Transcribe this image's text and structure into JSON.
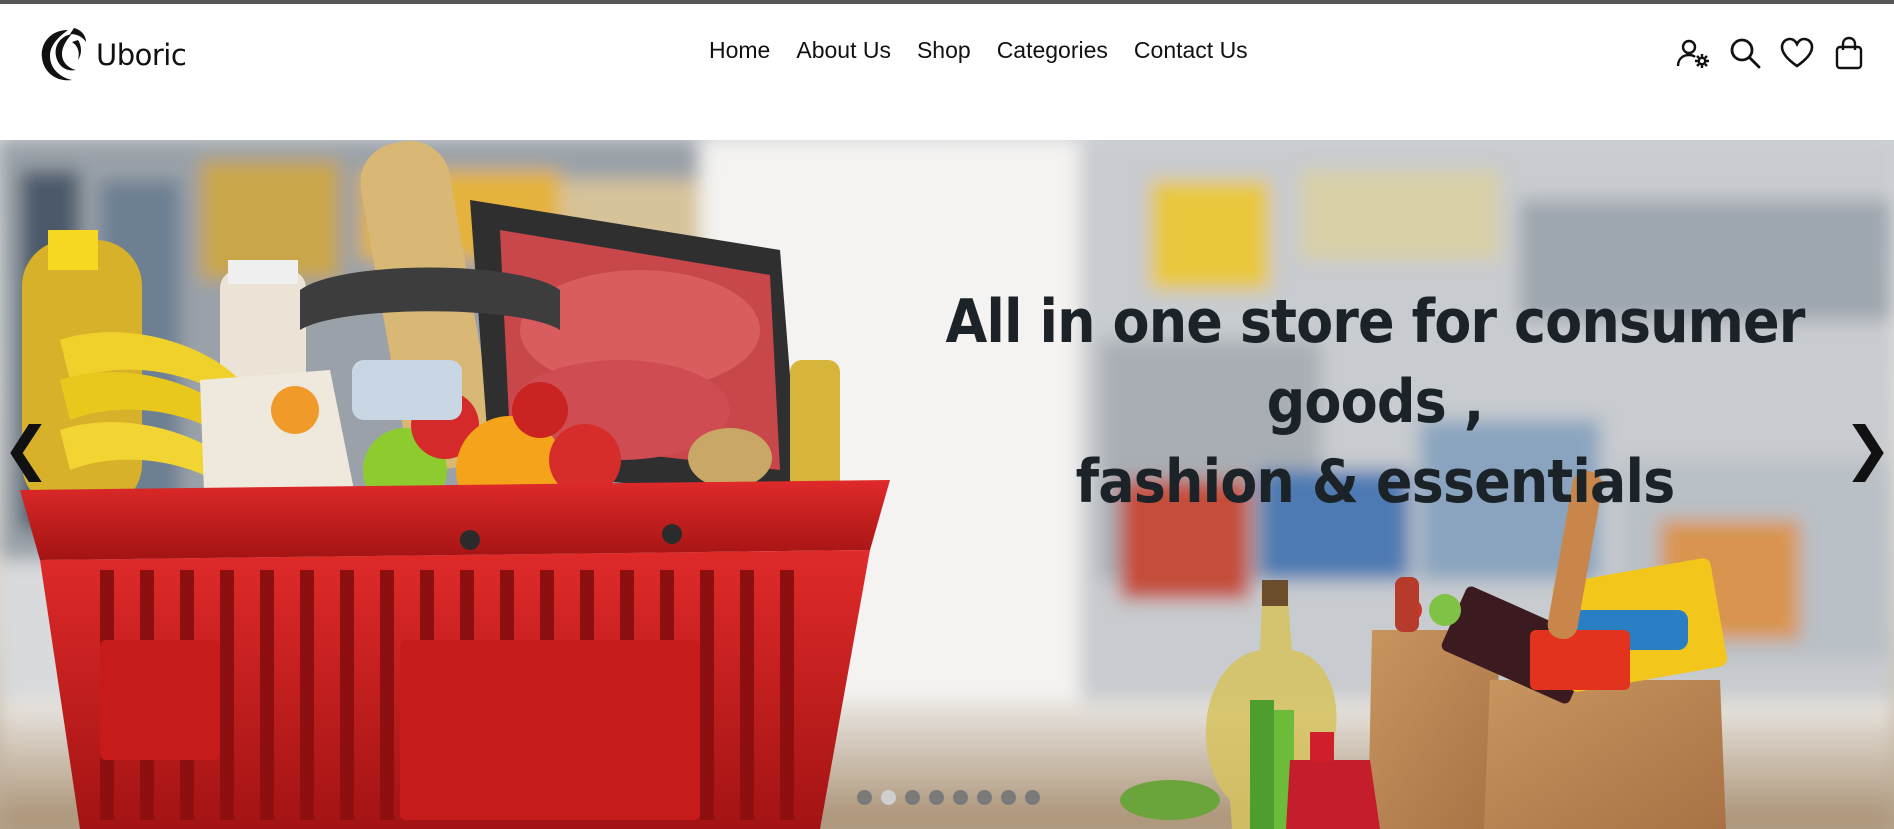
{
  "brand": {
    "name": "Uboric"
  },
  "nav": {
    "items": [
      {
        "label": "Home"
      },
      {
        "label": "About Us"
      },
      {
        "label": "Shop"
      },
      {
        "label": "Categories"
      },
      {
        "label": "Contact Us"
      }
    ]
  },
  "header_icons": [
    "user-settings-icon",
    "search-icon",
    "heart-icon",
    "shopping-bag-icon"
  ],
  "hero": {
    "headline_line1": "All in one store for consumer goods ,",
    "headline_line2": "fashion & essentials",
    "prev_arrow": "❮",
    "next_arrow": "❯",
    "slide_count": 8,
    "active_slide": 2
  },
  "colors": {
    "basket_red": "#d41f1f",
    "headline": "#1b2228",
    "dot_inactive": "#7a7a7a",
    "dot_active": "#cfcfcf"
  }
}
